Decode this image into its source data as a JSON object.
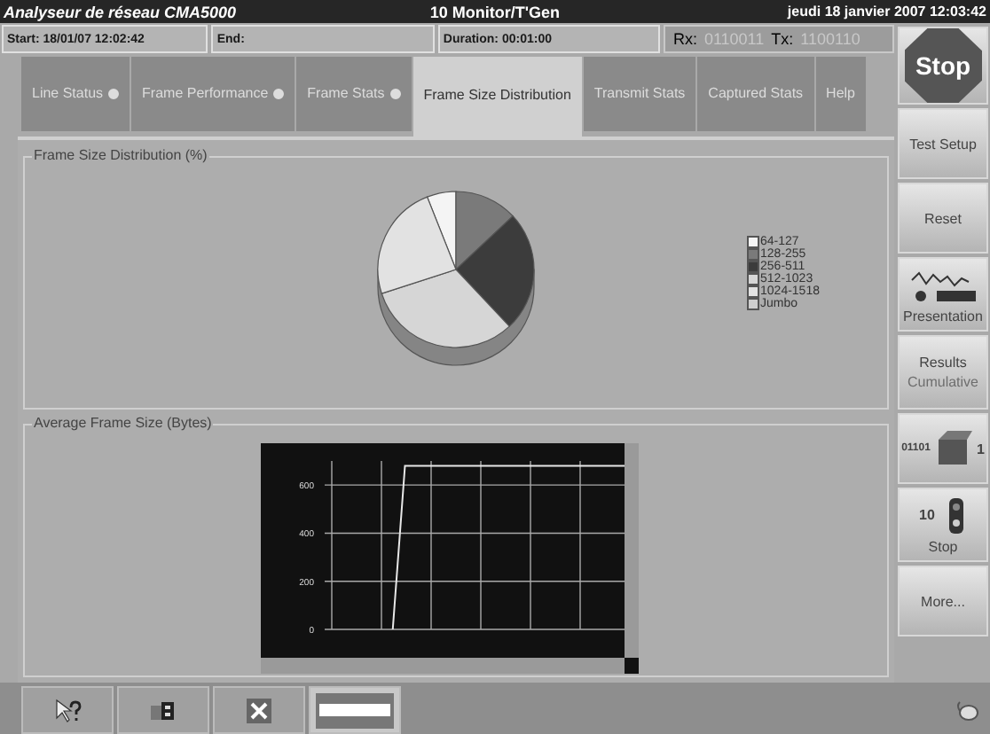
{
  "window": {
    "title": "Analyseur de réseau CMA5000",
    "mode": "10 Monitor/T'Gen",
    "datetime": "jeudi 18 janvier 2007 12:03:42"
  },
  "info_bar": {
    "start": "Start: 18/01/07 12:02:42",
    "end": "End:",
    "duration": "Duration: 00:01:00",
    "rx_label": "Rx:",
    "rx_value": "0110011",
    "tx_label": "Tx:",
    "tx_value": "1100110"
  },
  "tabs": [
    {
      "label": "Line Status",
      "selected": false,
      "indicator": true
    },
    {
      "label": "Frame Performance",
      "selected": false,
      "indicator": true
    },
    {
      "label": "Frame Stats",
      "selected": false,
      "indicator": true
    },
    {
      "label": "Frame Size Distribution",
      "selected": true,
      "indicator": false
    },
    {
      "label": "Transmit Stats",
      "selected": false,
      "indicator": false
    },
    {
      "label": "Captured Stats",
      "selected": false,
      "indicator": false
    },
    {
      "label": "Help",
      "selected": false,
      "indicator": false
    }
  ],
  "distribution": {
    "title": "Frame Size Distribution (%)",
    "legend": [
      {
        "label": "64-127",
        "color": "#f4f4f4"
      },
      {
        "label": "128-255",
        "color": "#7a7a7a"
      },
      {
        "label": "256-511",
        "color": "#3c3c3c"
      },
      {
        "label": "512-1023",
        "color": "#d6d6d6"
      },
      {
        "label": "1024-1518",
        "color": "#e2e2e2"
      },
      {
        "label": "Jumbo",
        "color": "#cfcfcf"
      }
    ]
  },
  "average": {
    "title": "Average Frame Size (Bytes)",
    "chart_data": {
      "type": "line",
      "grid": true,
      "ylim": [
        0,
        700
      ],
      "yticks": [
        0,
        200,
        400,
        600
      ],
      "series": [
        {
          "color": "#e8e8e8",
          "values": [
            null,
            null,
            null,
            null,
            null,
            0,
            680,
            680,
            680,
            680,
            680,
            680,
            680,
            680,
            680,
            680,
            680,
            680,
            680,
            680,
            680,
            680,
            680,
            680,
            680
          ]
        }
      ]
    }
  },
  "side_buttons": [
    {
      "kind": "stop",
      "label": "Stop"
    },
    {
      "kind": "text",
      "label": "Test Setup"
    },
    {
      "kind": "text",
      "label": "Reset"
    },
    {
      "kind": "presentation",
      "label": "Presentation"
    },
    {
      "kind": "results",
      "label": "Results",
      "sublabel": "Cumulative",
      "disabled": true
    },
    {
      "kind": "bits",
      "label": "01101",
      "sublabel": "1"
    },
    {
      "kind": "traffic",
      "label": "10",
      "sublabel": "Stop"
    },
    {
      "kind": "text",
      "label": "More..."
    }
  ],
  "toolbar": [
    {
      "kind": "help",
      "selected": false
    },
    {
      "kind": "windows",
      "selected": false
    },
    {
      "kind": "close",
      "selected": false
    },
    {
      "kind": "window",
      "selected": true
    }
  ]
}
